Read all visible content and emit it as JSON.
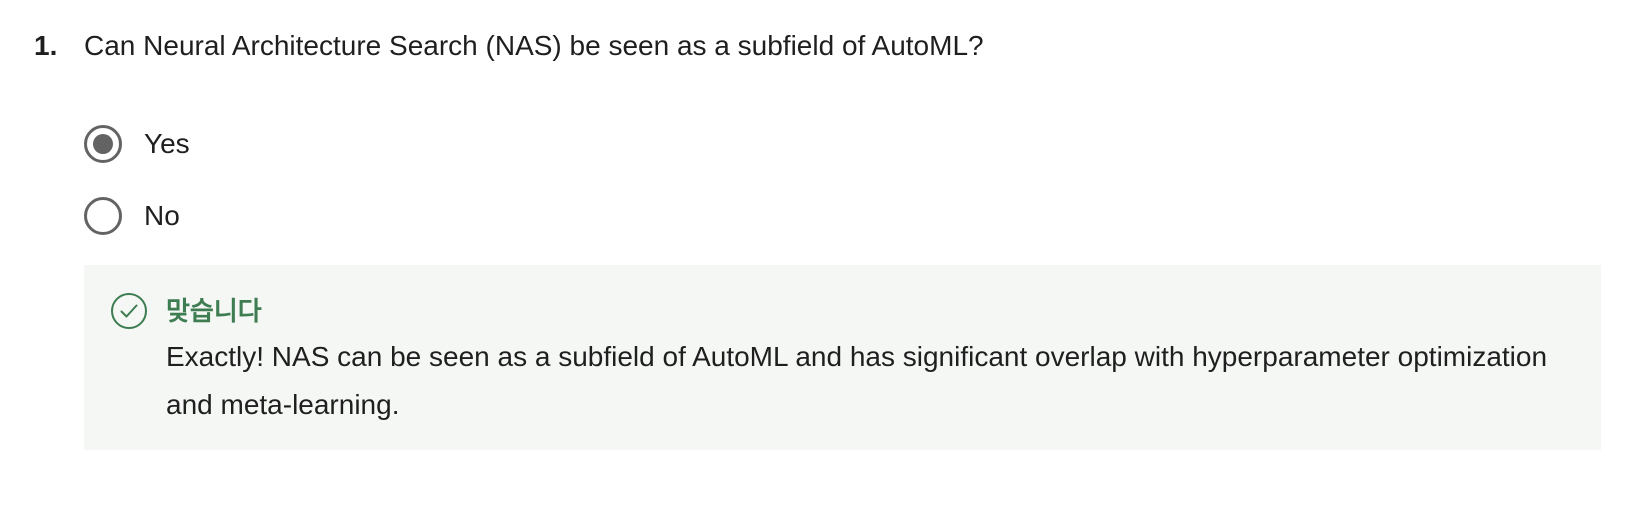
{
  "question": {
    "number": "1.",
    "text": "Can Neural Architecture Search (NAS) be seen as a subfield of AutoML?"
  },
  "options": [
    {
      "label": "Yes",
      "selected": true
    },
    {
      "label": "No",
      "selected": false
    }
  ],
  "feedback": {
    "status": "맞습니다",
    "message": "Exactly! NAS can be seen as a subfield of AutoML and has significant overlap with hyperparameter optimization and meta-learning.",
    "icon": "check-circle-icon",
    "accent_color": "#3e7c51",
    "background_color": "#f5f7f5"
  },
  "colors": {
    "radio_border": "#636363",
    "text": "#1f1f1f"
  }
}
